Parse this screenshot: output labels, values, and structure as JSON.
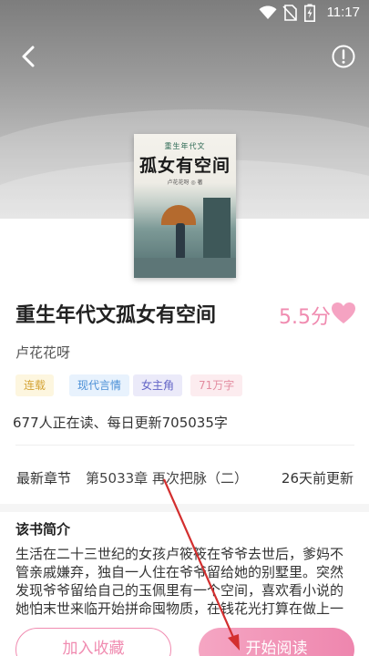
{
  "status_bar": {
    "time": "11:17"
  },
  "book": {
    "cover": {
      "top_text": "重生年代文",
      "title": "孤女有空间",
      "author_line": "卢花花呀 ◎ 著"
    },
    "title": "重生年代文孤女有空间",
    "score": "5.5分",
    "author": "卢花花呀",
    "tags": [
      "连载",
      "现代言情",
      "女主角",
      "71万字"
    ],
    "readers_line": "677人正在读、每日更新705035字"
  },
  "chapter": {
    "label": "最新章节",
    "latest": "第5033章 再次把脉（二）",
    "updated": "26天前更新"
  },
  "intro": {
    "heading": "该书简介",
    "text": "生活在二十三世纪的女孩卢筱筱在爷爷去世后，爹妈不管亲戚嫌弃，独自一人住在爷爷留给她的别墅里。突然发现爷爷留给自己的玉佩里有一个空间，喜欢看小说的她怕末世来临开始拼命囤物质，在钱花光打算在做上一个任务..."
  },
  "actions": {
    "add_favorite": "加入收藏",
    "start_reading": "开始阅读"
  },
  "colors": {
    "accent_pink": "#f08bb0",
    "annotation_arrow": "#d32f2f"
  }
}
